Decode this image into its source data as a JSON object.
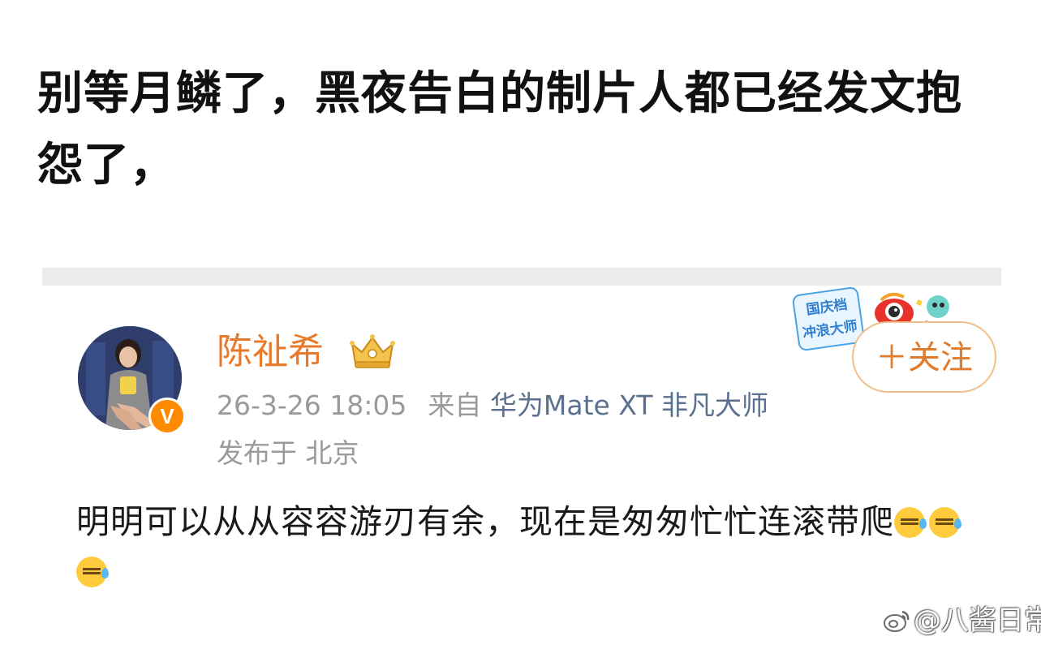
{
  "headline": "别等月鳞了，黑夜告白的制片人都已经发文抱怨了，",
  "post": {
    "username": "陈祉希",
    "verified_badge": "V",
    "time": "26-3-26 18:05",
    "source_prefix": "来自",
    "device": "华为Mate XT 非凡大师",
    "location": "发布于 北京",
    "text": "明明可以从从容容游刃有余，现在是匆匆忙忙连滚带爬",
    "emoji_count": 3
  },
  "follow_button": {
    "label": "＋关注"
  },
  "festival_badge": {
    "line1": "国庆档",
    "line2": "冲浪大师"
  },
  "watermark": {
    "text": "@八酱日常"
  },
  "icons": {
    "crown": "vip-crown-icon",
    "emoji": "sweat-emoji-icon",
    "weibo": "weibo-logo-icon"
  },
  "colors": {
    "username": "#e87a2b",
    "device": "#5b6f8f",
    "meta": "#9a9a9a",
    "follow": "#e07b2c",
    "badge": "#ff8a00"
  }
}
